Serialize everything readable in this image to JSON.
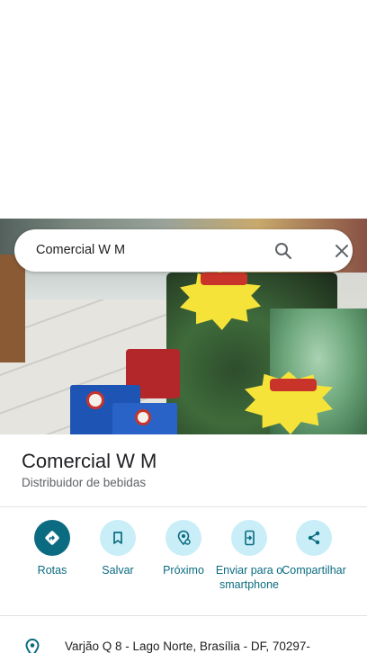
{
  "search": {
    "query": "Comercial W M"
  },
  "photo": {
    "sign_badge_1": "Promoção",
    "sign_text_1": "REFRIGERANTE KUAT 2 LITROS R$ 5,99",
    "sign_badge_2": "Promoção",
    "sign_text_2": "REFRIGERANTE GUARANÁ TAC 2 LITROS R$ 3,99"
  },
  "place": {
    "name": "Comercial W M",
    "category": "Distribuidor de bebidas"
  },
  "actions": [
    {
      "label": "Rotas",
      "icon": "directions-icon"
    },
    {
      "label": "Salvar",
      "icon": "bookmark-icon"
    },
    {
      "label": "Próximo",
      "icon": "nearby-icon"
    },
    {
      "label": "Enviar para o smartphone",
      "icon": "send-to-phone-icon"
    },
    {
      "label": "Compartilhar",
      "icon": "share-icon"
    }
  ],
  "address": {
    "text": "Varjão Q 8 - Lago Norte, Brasília - DF, 70297-"
  },
  "colors": {
    "accent": "#0b6b80",
    "accent_light": "#c9eef8",
    "text_primary": "#202124",
    "text_secondary": "#5f6368"
  }
}
